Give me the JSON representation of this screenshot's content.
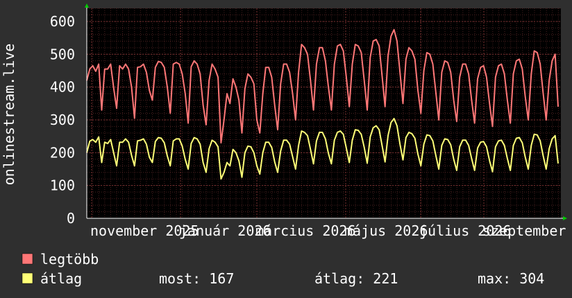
{
  "chart_data": {
    "type": "line",
    "ylabel": "onlinestream.live",
    "ylim": [
      0,
      640
    ],
    "yticks": [
      0,
      100,
      200,
      300,
      400,
      500,
      600
    ],
    "x_tick_labels": [
      "november 2025",
      "január 2026",
      "március 2026",
      "május 2026",
      "július 2026",
      "szeptember"
    ],
    "grid": true,
    "colors": {
      "background": "#2f2f2f",
      "plot_background": "#000000",
      "grid": "#5a2a2a",
      "axis_marker": "#00cc00",
      "max_series": "#ff7777",
      "avg_series": "#ffff77"
    },
    "series": [
      {
        "name": "legtöbb",
        "values": [
          420,
          455,
          465,
          448,
          470,
          330,
          455,
          455,
          470,
          398,
          335,
          465,
          455,
          470,
          455,
          400,
          305,
          460,
          462,
          470,
          445,
          390,
          360,
          460,
          478,
          475,
          460,
          400,
          320,
          470,
          475,
          470,
          440,
          380,
          290,
          462,
          480,
          470,
          440,
          345,
          285,
          420,
          470,
          455,
          430,
          230,
          300,
          380,
          350,
          425,
          400,
          360,
          260,
          395,
          440,
          430,
          410,
          300,
          260,
          380,
          460,
          460,
          430,
          345,
          270,
          410,
          470,
          470,
          445,
          380,
          300,
          445,
          530,
          520,
          500,
          420,
          330,
          470,
          520,
          520,
          480,
          400,
          330,
          470,
          525,
          530,
          510,
          430,
          340,
          470,
          530,
          525,
          505,
          420,
          330,
          490,
          540,
          545,
          525,
          435,
          340,
          495,
          555,
          575,
          540,
          445,
          350,
          485,
          520,
          510,
          485,
          390,
          320,
          450,
          505,
          500,
          470,
          385,
          300,
          445,
          480,
          475,
          445,
          360,
          295,
          430,
          470,
          470,
          440,
          360,
          290,
          425,
          460,
          465,
          430,
          350,
          280,
          430,
          465,
          470,
          440,
          360,
          290,
          440,
          480,
          485,
          455,
          370,
          300,
          440,
          510,
          505,
          470,
          380,
          300,
          420,
          480,
          500,
          340
        ]
      },
      {
        "name": "átlag",
        "values": [
          200,
          235,
          240,
          232,
          248,
          170,
          232,
          228,
          240,
          200,
          160,
          232,
          232,
          242,
          232,
          192,
          160,
          236,
          238,
          242,
          226,
          186,
          170,
          234,
          246,
          244,
          230,
          190,
          160,
          236,
          242,
          242,
          220,
          180,
          150,
          228,
          246,
          242,
          226,
          170,
          140,
          212,
          238,
          232,
          218,
          120,
          140,
          170,
          160,
          210,
          200,
          175,
          125,
          200,
          220,
          218,
          200,
          160,
          135,
          200,
          232,
          232,
          216,
          172,
          140,
          205,
          238,
          238,
          226,
          188,
          150,
          222,
          266,
          262,
          252,
          210,
          166,
          236,
          262,
          262,
          242,
          198,
          166,
          238,
          262,
          266,
          256,
          214,
          170,
          238,
          270,
          268,
          256,
          216,
          168,
          248,
          276,
          282,
          270,
          222,
          172,
          252,
          292,
          304,
          282,
          226,
          178,
          246,
          262,
          258,
          244,
          196,
          160,
          226,
          254,
          252,
          236,
          192,
          150,
          222,
          242,
          240,
          224,
          180,
          146,
          218,
          238,
          238,
          222,
          182,
          146,
          214,
          232,
          234,
          218,
          176,
          142,
          218,
          236,
          238,
          222,
          182,
          146,
          222,
          244,
          246,
          230,
          186,
          150,
          222,
          256,
          254,
          236,
          190,
          150,
          212,
          242,
          252,
          167
        ]
      }
    ],
    "legend": [
      {
        "label": "legtöbb",
        "color": "#ff7777"
      },
      {
        "label": "átlag",
        "color": "#ffff77"
      }
    ],
    "stats": {
      "now": "most: 167",
      "avg": "átlag: 221",
      "max": "max: 304"
    }
  }
}
